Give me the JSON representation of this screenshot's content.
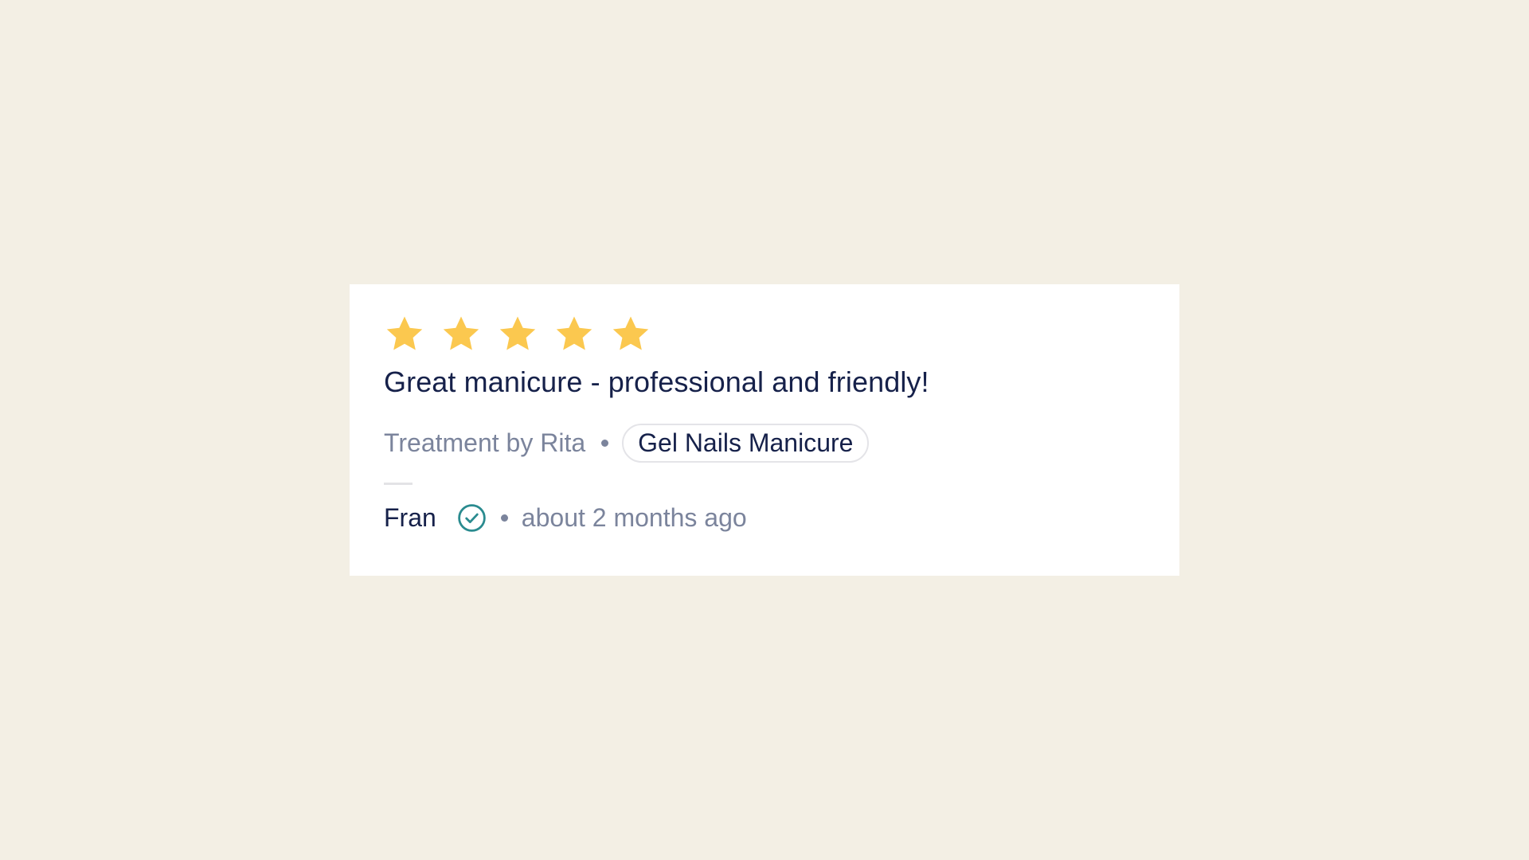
{
  "review": {
    "rating": 5,
    "max_rating": 5,
    "star_color": "#fbc84f",
    "title": "Great manicure - professional and friendly!",
    "treatment_by": "Treatment by Rita",
    "service": "Gel Nails Manicure",
    "author": "Fran",
    "verified_icon": "check-circle-icon",
    "verified_color": "#2a8b8f",
    "time_ago": "about 2 months ago"
  }
}
